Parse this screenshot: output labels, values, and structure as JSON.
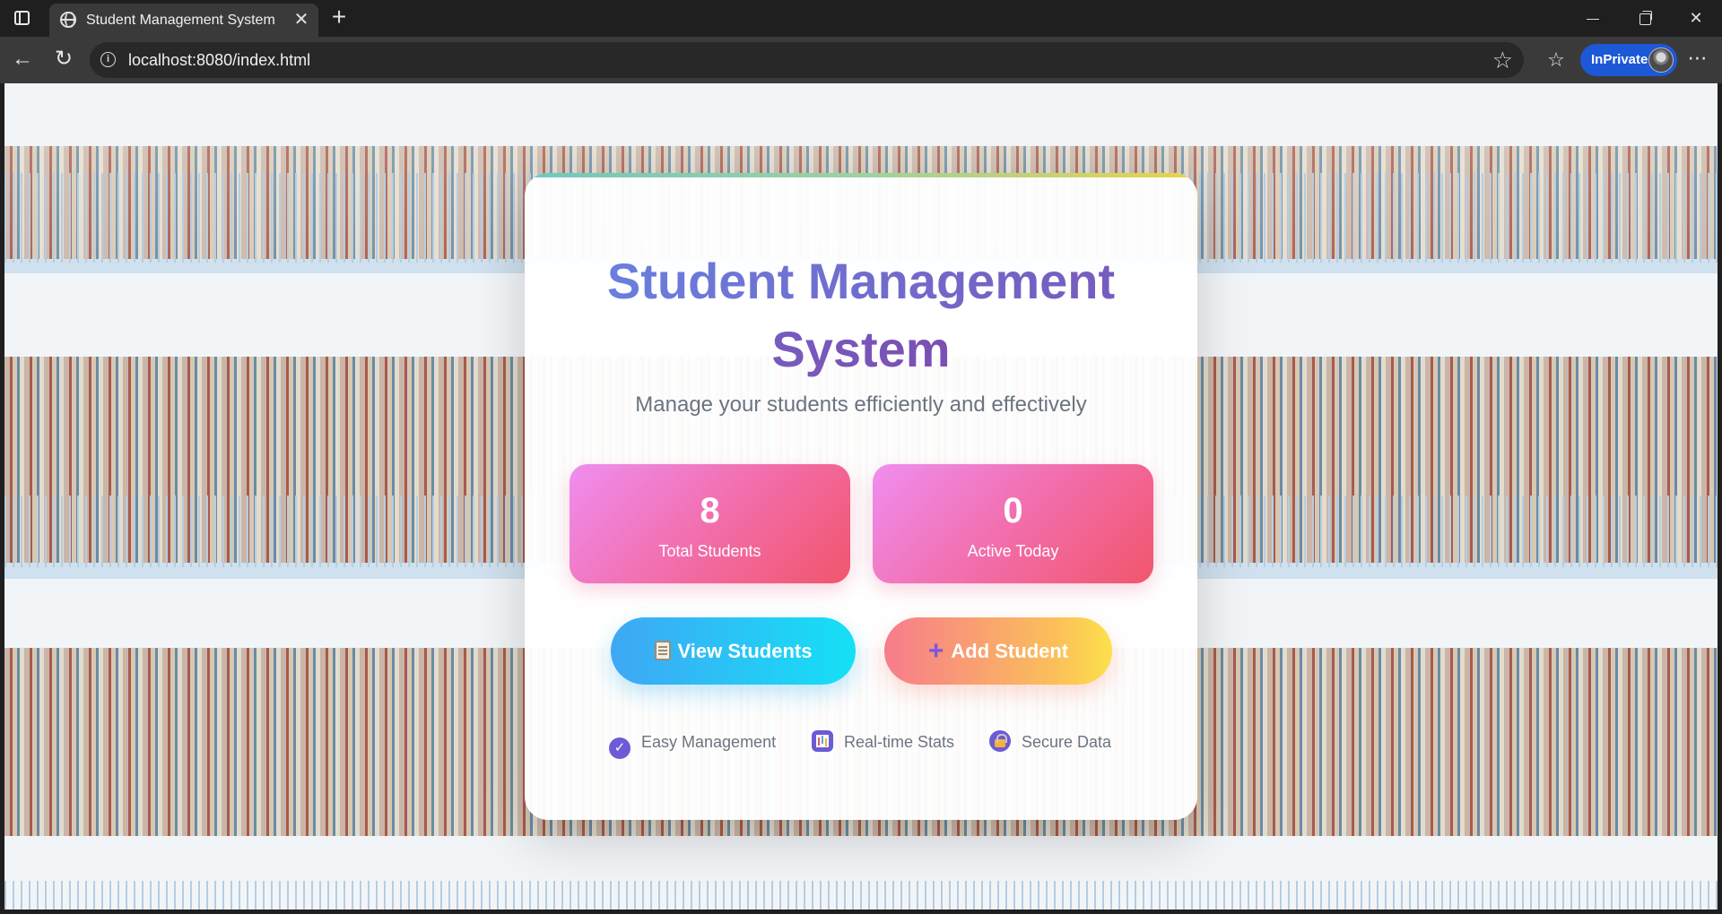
{
  "browser": {
    "tab_title": "Student Management System",
    "url": "localhost:8080/index.html",
    "inprivate_label": "InPrivate",
    "icons": {
      "tab_actions": "tab-actions-icon",
      "tab": "globe-icon",
      "tab_close": "close-icon",
      "new_tab": "plus-icon",
      "back": "back-arrow-icon",
      "reload": "reload-icon",
      "site_info": "info-icon",
      "favorite": "star-icon",
      "favorites_bar": "favorites-icon",
      "more": "more-icon"
    }
  },
  "page": {
    "title": "Student Management System",
    "subtitle": "Manage your students efficiently and effectively",
    "stats": [
      {
        "value": "8",
        "label": "Total Students"
      },
      {
        "value": "0",
        "label": "Active Today"
      }
    ],
    "buttons": {
      "view_students": "View Students",
      "add_student": "Add Student"
    },
    "features": [
      {
        "icon": "check-icon",
        "label": "Easy Management"
      },
      {
        "icon": "chart-icon",
        "label": "Real-time Stats"
      },
      {
        "icon": "lock-icon",
        "label": "Secure Data"
      }
    ],
    "colors": {
      "title_gradient": [
        "#6a7ede",
        "#7b4fb3"
      ],
      "stat_gradient": [
        "#ef8ef0",
        "#f1566b"
      ],
      "view_button_gradient": [
        "#3fa7f5",
        "#15e0f5"
      ],
      "add_button_gradient": [
        "#f77c8c",
        "#fde04c"
      ]
    }
  }
}
